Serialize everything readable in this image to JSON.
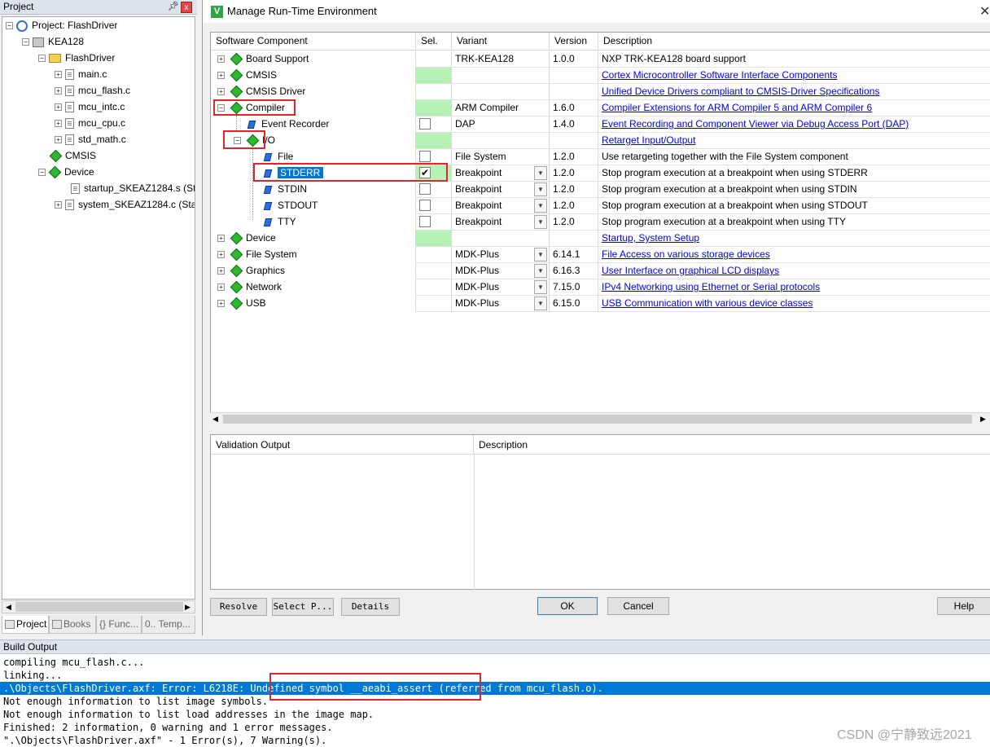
{
  "project_panel": {
    "header": "Project",
    "pin": "ᵖ",
    "close": "x",
    "tree": [
      {
        "label": "Project: FlashDriver",
        "kind": "project"
      },
      {
        "label": "KEA128",
        "kind": "target"
      },
      {
        "label": "FlashDriver",
        "kind": "folder"
      },
      {
        "label": "main.c",
        "kind": "file"
      },
      {
        "label": "mcu_flash.c",
        "kind": "file"
      },
      {
        "label": "mcu_intc.c",
        "kind": "file"
      },
      {
        "label": "mcu_cpu.c",
        "kind": "file"
      },
      {
        "label": "std_math.c",
        "kind": "file"
      },
      {
        "label": "CMSIS",
        "kind": "component"
      },
      {
        "label": "Device",
        "kind": "component"
      },
      {
        "label": "startup_SKEAZ1284.s (Sta",
        "kind": "file"
      },
      {
        "label": "system_SKEAZ1284.c (Sta",
        "kind": "file"
      }
    ],
    "tabs": [
      "Project",
      "Books",
      "{} Func...",
      "0.. Temp..."
    ]
  },
  "dialog": {
    "title": "Manage Run-Time Environment",
    "close": "✕",
    "columns": [
      "Software Component",
      "Sel.",
      "Variant",
      "Version",
      "Description"
    ],
    "rows": [
      {
        "name": "Board Support",
        "sel_green": false,
        "checkbox": false,
        "checked": false,
        "variant": "TRK-KEA128",
        "dropdown": false,
        "version": "1.0.0",
        "description": "NXP TRK-KEA128 board support",
        "link": false
      },
      {
        "name": "CMSIS",
        "sel_green": true,
        "checkbox": false,
        "checked": false,
        "variant": "",
        "dropdown": false,
        "version": "",
        "description": "Cortex Microcontroller Software Interface Components",
        "link": true
      },
      {
        "name": "CMSIS Driver",
        "sel_green": false,
        "checkbox": false,
        "checked": false,
        "variant": "",
        "dropdown": false,
        "version": "",
        "description": "Unified Device Drivers compliant to CMSIS-Driver Specifications",
        "link": true
      },
      {
        "name": "Compiler",
        "sel_green": true,
        "checkbox": false,
        "checked": false,
        "variant": "ARM Compiler",
        "dropdown": false,
        "version": "1.6.0",
        "description": "Compiler Extensions for ARM Compiler 5 and ARM Compiler 6",
        "link": true
      },
      {
        "name": "Event Recorder",
        "sel_green": false,
        "checkbox": true,
        "checked": false,
        "variant": "DAP",
        "dropdown": false,
        "version": "1.4.0",
        "description": "Event Recording and Component Viewer via Debug Access Port (DAP)",
        "link": true
      },
      {
        "name": "I/O",
        "sel_green": true,
        "checkbox": false,
        "checked": false,
        "variant": "",
        "dropdown": false,
        "version": "",
        "description": "Retarget Input/Output",
        "link": true
      },
      {
        "name": "File",
        "sel_green": false,
        "checkbox": true,
        "checked": false,
        "variant": "File System",
        "dropdown": false,
        "version": "1.2.0",
        "description": "Use retargeting together with the File System component",
        "link": false
      },
      {
        "name": "STDERR",
        "sel_green": true,
        "checkbox": true,
        "checked": true,
        "variant": "Breakpoint",
        "dropdown": true,
        "version": "1.2.0",
        "description": "Stop program execution at a breakpoint when using STDERR",
        "link": false
      },
      {
        "name": "STDIN",
        "sel_green": false,
        "checkbox": true,
        "checked": false,
        "variant": "Breakpoint",
        "dropdown": true,
        "version": "1.2.0",
        "description": "Stop program execution at a breakpoint when using STDIN",
        "link": false
      },
      {
        "name": "STDOUT",
        "sel_green": false,
        "checkbox": true,
        "checked": false,
        "variant": "Breakpoint",
        "dropdown": true,
        "version": "1.2.0",
        "description": "Stop program execution at a breakpoint when using STDOUT",
        "link": false
      },
      {
        "name": "TTY",
        "sel_green": false,
        "checkbox": true,
        "checked": false,
        "variant": "Breakpoint",
        "dropdown": true,
        "version": "1.2.0",
        "description": "Stop program execution at a breakpoint when using TTY",
        "link": false
      },
      {
        "name": "Device",
        "sel_green": true,
        "checkbox": false,
        "checked": false,
        "variant": "",
        "dropdown": false,
        "version": "",
        "description": "Startup, System Setup",
        "link": true
      },
      {
        "name": "File System",
        "sel_green": false,
        "checkbox": false,
        "checked": false,
        "variant": "MDK-Plus",
        "dropdown": true,
        "version": "6.14.1",
        "description": "File Access on various storage devices",
        "link": true
      },
      {
        "name": "Graphics",
        "sel_green": false,
        "checkbox": false,
        "checked": false,
        "variant": "MDK-Plus",
        "dropdown": true,
        "version": "6.16.3",
        "description": "User Interface on graphical LCD displays",
        "link": true
      },
      {
        "name": "Network",
        "sel_green": false,
        "checkbox": false,
        "checked": false,
        "variant": "MDK-Plus",
        "dropdown": true,
        "version": "7.15.0",
        "description": "IPv4 Networking using Ethernet or Serial protocols",
        "link": true
      },
      {
        "name": "USB",
        "sel_green": false,
        "checkbox": false,
        "checked": false,
        "variant": "MDK-Plus",
        "dropdown": true,
        "version": "6.15.0",
        "description": "USB Communication with various device classes",
        "link": true
      }
    ],
    "validation": {
      "col1": "Validation Output",
      "col2": "Description"
    },
    "buttons": {
      "resolve": "Resolve",
      "select_packs": "Select P...",
      "details": "Details",
      "ok": "OK",
      "cancel": "Cancel",
      "help": "Help"
    }
  },
  "build_output": {
    "header": "Build Output",
    "lines": [
      "compiling mcu_flash.c...",
      "linking...",
      ".\\Objects\\FlashDriver.axf: Error: L6218E: Undefined symbol __aeabi_assert (referred from mcu_flash.o).",
      "Not enough information to list image symbols.",
      "Not enough information to list load addresses in the image map.",
      "Finished: 2 information, 0 warning and 1 error messages.",
      "\".\\Objects\\FlashDriver.axf\" - 1 Error(s), 7 Warning(s)."
    ],
    "error_line_index": 2
  },
  "watermark": "CSDN @宁静致远2021"
}
